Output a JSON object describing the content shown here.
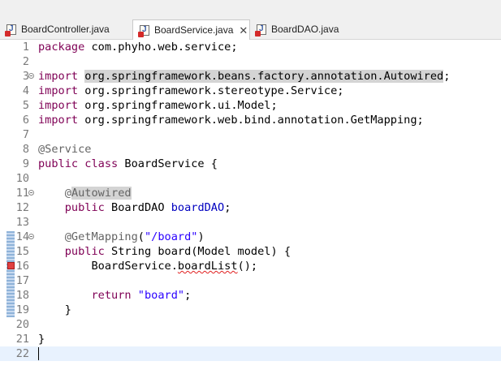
{
  "tabs": [
    {
      "label": "BoardController.java",
      "active": false,
      "has_error": true
    },
    {
      "label": "BoardService.java",
      "active": true,
      "has_error": true
    },
    {
      "label": "BoardDAO.java",
      "active": false,
      "has_error": true
    }
  ],
  "lines": [
    {
      "num": "1"
    },
    {
      "num": "2"
    },
    {
      "num": "3",
      "fold": true
    },
    {
      "num": "4"
    },
    {
      "num": "5"
    },
    {
      "num": "6"
    },
    {
      "num": "7"
    },
    {
      "num": "8"
    },
    {
      "num": "9"
    },
    {
      "num": "10"
    },
    {
      "num": "11",
      "fold": true
    },
    {
      "num": "12"
    },
    {
      "num": "13"
    },
    {
      "num": "14",
      "fold": true
    },
    {
      "num": "15"
    },
    {
      "num": "16"
    },
    {
      "num": "17"
    },
    {
      "num": "18"
    },
    {
      "num": "19"
    },
    {
      "num": "20"
    },
    {
      "num": "21"
    },
    {
      "num": "22"
    }
  ],
  "code": {
    "l1": {
      "kw": "package",
      "rest": " com.phyho.web.service;"
    },
    "l3": {
      "kw": "import",
      "hl": "org.springframework.beans.factory.annotation.Autowired",
      "rest": ";"
    },
    "l4": {
      "kw": "import",
      "rest": " org.springframework.stereotype.Service;"
    },
    "l5": {
      "kw": "import",
      "rest": " org.springframework.ui.Model;"
    },
    "l6": {
      "kw": "import",
      "rest": " org.springframework.web.bind.annotation.GetMapping;"
    },
    "l8": {
      "ann": "@Service"
    },
    "l9": {
      "kw1": "public",
      "kw2": "class",
      "rest": " BoardService {"
    },
    "l11": {
      "at": "@",
      "hl": "Autowired"
    },
    "l12": {
      "kw": "public",
      "type": " BoardDAO ",
      "field": "boardDAO",
      "rest": ";"
    },
    "l14": {
      "ann": "@GetMapping",
      "open": "(",
      "str": "\"/board\"",
      "close": ")"
    },
    "l15": {
      "kw": "public",
      "rest": " String board(Model model) {"
    },
    "l16": {
      "pre": "BoardService.",
      "err": "boardList",
      "rest": "();"
    },
    "l18": {
      "kw": "return",
      "str": "\"board\"",
      "rest": ";"
    },
    "l19": {
      "rest": "}"
    },
    "l21": {
      "rest": "}"
    }
  }
}
